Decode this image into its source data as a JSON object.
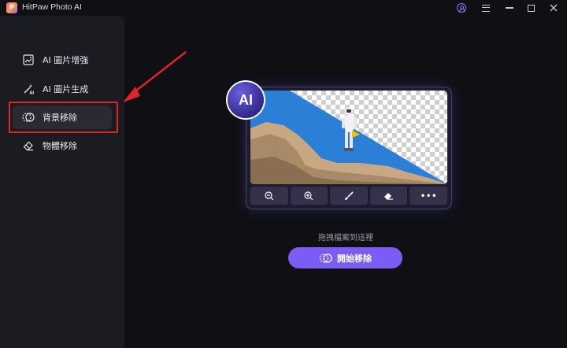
{
  "app": {
    "logo_letter": "P",
    "title": "HitPaw Photo AI",
    "accent": "#7b5cf4"
  },
  "window": {
    "icons": [
      "user-icon",
      "menu-icon",
      "minimize-icon",
      "maximize-icon",
      "close-icon"
    ]
  },
  "sidebar": {
    "items": [
      {
        "label": "AI 圖片增強",
        "icon": "image-enhance-icon"
      },
      {
        "label": "AI 圖片生成",
        "icon": "magic-wand-icon"
      },
      {
        "label": "背景移除",
        "icon": "background-remove-icon",
        "active": true
      },
      {
        "label": "物體移除",
        "icon": "eraser-icon"
      }
    ]
  },
  "annotation": {
    "highlight_color": "#e0242c"
  },
  "preview": {
    "badge": "AI",
    "tools": [
      "zoom-out-icon",
      "zoom-in-icon",
      "brush-icon",
      "eraser-icon",
      "more-icon"
    ],
    "more_label": "•••"
  },
  "main": {
    "drop_hint": "拖拽檔案到這裡",
    "start_button": "開始移除"
  }
}
